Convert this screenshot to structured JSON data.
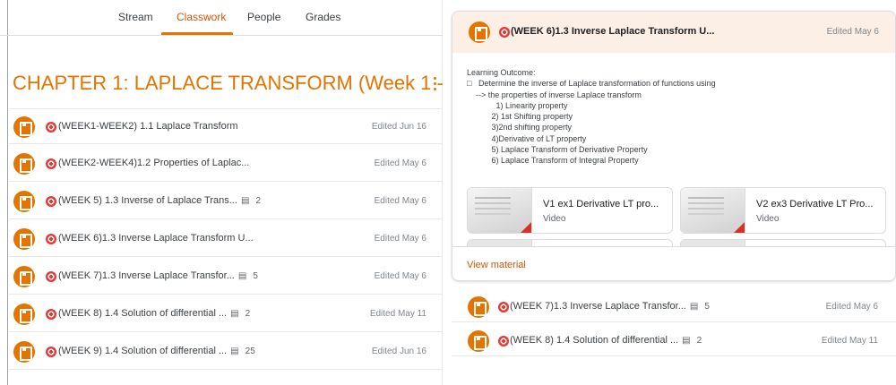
{
  "tabs": [
    {
      "label": "Stream"
    },
    {
      "label": "Classwork"
    },
    {
      "label": "People"
    },
    {
      "label": "Grades"
    }
  ],
  "chapter": {
    "title": "CHAPTER 1: LAPLACE TRANSFORM (Week 1 - ..."
  },
  "rows": [
    {
      "title": "(WEEK1-WEEK2) 1.1 Laplace Transform",
      "comments": "",
      "date": "Edited Jun 16"
    },
    {
      "title": "(WEEK2-WEEK4)1.2 Properties of Laplac...",
      "comments": "",
      "date": "Edited May 6"
    },
    {
      "title": "(WEEK 5) 1.3 Inverse of Laplace Trans...",
      "comments": "2",
      "date": "Edited May 6"
    },
    {
      "title": "(WEEK 6)1.3 Inverse Laplace Transform U...",
      "comments": "",
      "date": "Edited May 6"
    },
    {
      "title": "(WEEK 7)1.3 Inverse Laplace Transfor...",
      "comments": "5",
      "date": "Edited May 6"
    },
    {
      "title": "(WEEK 8) 1.4 Solution of differential ...",
      "comments": "2",
      "date": "Edited May 11"
    },
    {
      "title": "(WEEK 9) 1.4 Solution of differential ...",
      "comments": "25",
      "date": "Edited Jun 16"
    }
  ],
  "expanded": {
    "title": "(WEEK 6)1.3 Inverse Laplace Transform U...",
    "date": "Edited May 6",
    "description": [
      "Learning Outcome:",
      "□   Determine the inverse of Laplace transformation of functions using",
      "    --> the properties of inverse Laplace transform",
      "             1) Linearity property",
      "           2) 1st Shifting property",
      "           3)2nd shifting property",
      "           4)Derivative of LT property",
      "           5) Laplace Transform of Derivative Property",
      "           6) Laplace Transform of Integral Property"
    ],
    "attachments": [
      {
        "title": "V1 ex1 Derivative LT pro...",
        "type": "Video"
      },
      {
        "title": "V2 ex3 Derivative LT Pro...",
        "type": "Video"
      }
    ],
    "view_label": "View material"
  },
  "right_rows": [
    {
      "title": "(WEEK 7)1.3 Inverse Laplace Transfor...",
      "comments": "5",
      "date": "Edited May 6"
    },
    {
      "title": "(WEEK 8) 1.4 Solution of differential ...",
      "comments": "2",
      "date": "Edited May 11"
    }
  ],
  "colors": {
    "accent": "#e37400",
    "header_bg": "#fcefe5",
    "target_red": "#e53935"
  },
  "icons": {
    "material": "assignment-icon",
    "target": "target-icon",
    "comments": "comment-icon",
    "more": "more-vert-icon"
  }
}
